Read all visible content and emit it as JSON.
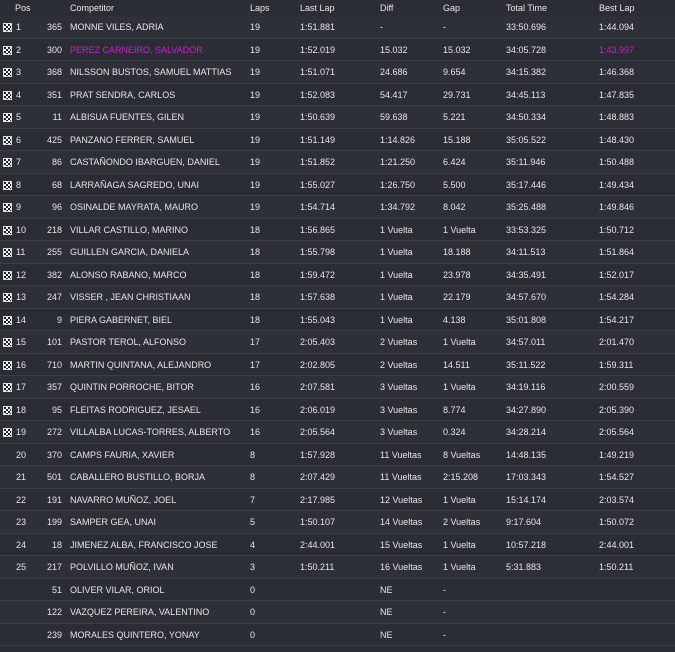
{
  "headers": {
    "pos": "Pos",
    "competitor": "Competitor",
    "laps": "Laps",
    "last_lap": "Last Lap",
    "diff": "Diff",
    "gap": "Gap",
    "total": "Total Time",
    "best": "Best Lap"
  },
  "highlight_color": "#d11cd1",
  "flag_icon": "checkered-flag-icon",
  "rows": [
    {
      "pos": "1",
      "num": "365",
      "name": "MONNE VILES, ADRIA",
      "laps": "19",
      "last": "1:51.881",
      "diff": "-",
      "gap": "-",
      "total": "33:50.696",
      "best": "1:44.094",
      "flag": true,
      "hi": false
    },
    {
      "pos": "2",
      "num": "300",
      "name": "PEREZ CARNEIRO, SALVADOR",
      "laps": "19",
      "last": "1:52.019",
      "diff": "15.032",
      "gap": "15.032",
      "total": "34:05.728",
      "best": "1:43.997",
      "flag": true,
      "hi": true
    },
    {
      "pos": "3",
      "num": "368",
      "name": "NILSSON BUSTOS, SAMUEL MATTIAS",
      "laps": "19",
      "last": "1:51.071",
      "diff": "24.686",
      "gap": "9.654",
      "total": "34:15.382",
      "best": "1:46.368",
      "flag": true,
      "hi": false
    },
    {
      "pos": "4",
      "num": "351",
      "name": "PRAT SENDRA, CARLOS",
      "laps": "19",
      "last": "1:52.083",
      "diff": "54.417",
      "gap": "29.731",
      "total": "34:45.113",
      "best": "1:47.835",
      "flag": true,
      "hi": false
    },
    {
      "pos": "5",
      "num": "11",
      "name": "ALBISUA FUENTES, GILEN",
      "laps": "19",
      "last": "1:50.639",
      "diff": "59.638",
      "gap": "5.221",
      "total": "34:50.334",
      "best": "1:48.883",
      "flag": true,
      "hi": false
    },
    {
      "pos": "6",
      "num": "425",
      "name": "PANZANO FERRER, SAMUEL",
      "laps": "19",
      "last": "1:51.149",
      "diff": "1:14.826",
      "gap": "15.188",
      "total": "35:05.522",
      "best": "1:48.430",
      "flag": true,
      "hi": false
    },
    {
      "pos": "7",
      "num": "86",
      "name": "CASTAÑONDO IBARGUEN, DANIEL",
      "laps": "19",
      "last": "1:51.852",
      "diff": "1:21.250",
      "gap": "6.424",
      "total": "35:11.946",
      "best": "1:50.488",
      "flag": true,
      "hi": false
    },
    {
      "pos": "8",
      "num": "68",
      "name": "LARRAÑAGA SAGREDO, UNAI",
      "laps": "19",
      "last": "1:55.027",
      "diff": "1:26.750",
      "gap": "5.500",
      "total": "35:17.446",
      "best": "1:49.434",
      "flag": true,
      "hi": false
    },
    {
      "pos": "9",
      "num": "96",
      "name": "OSINALDE MAYRATA, MAURO",
      "laps": "19",
      "last": "1:54.714",
      "diff": "1:34.792",
      "gap": "8.042",
      "total": "35:25.488",
      "best": "1:49.846",
      "flag": true,
      "hi": false
    },
    {
      "pos": "10",
      "num": "218",
      "name": "VILLAR CASTILLO, MARINO",
      "laps": "18",
      "last": "1:56.865",
      "diff": "1 Vuelta",
      "gap": "1 Vuelta",
      "total": "33:53.325",
      "best": "1:50.712",
      "flag": true,
      "hi": false
    },
    {
      "pos": "11",
      "num": "255",
      "name": "GUILLEN GARCIA, DANIELA",
      "laps": "18",
      "last": "1:55.798",
      "diff": "1 Vuelta",
      "gap": "18.188",
      "total": "34:11.513",
      "best": "1:51.864",
      "flag": true,
      "hi": false
    },
    {
      "pos": "12",
      "num": "382",
      "name": "ALONSO RABANO, MARCO",
      "laps": "18",
      "last": "1:59.472",
      "diff": "1 Vuelta",
      "gap": "23.978",
      "total": "34:35.491",
      "best": "1:52.017",
      "flag": true,
      "hi": false
    },
    {
      "pos": "13",
      "num": "247",
      "name": "VISSER , JEAN CHRISTIAAN",
      "laps": "18",
      "last": "1:57.638",
      "diff": "1 Vuelta",
      "gap": "22.179",
      "total": "34:57.670",
      "best": "1:54.284",
      "flag": true,
      "hi": false
    },
    {
      "pos": "14",
      "num": "9",
      "name": "PIERA GABERNET, BIEL",
      "laps": "18",
      "last": "1:55.043",
      "diff": "1 Vuelta",
      "gap": "4.138",
      "total": "35:01.808",
      "best": "1:54.217",
      "flag": true,
      "hi": false
    },
    {
      "pos": "15",
      "num": "101",
      "name": "PASTOR TEROL, ALFONSO",
      "laps": "17",
      "last": "2:05.403",
      "diff": "2 Vueltas",
      "gap": "1 Vuelta",
      "total": "34:57.011",
      "best": "2:01.470",
      "flag": true,
      "hi": false
    },
    {
      "pos": "16",
      "num": "710",
      "name": "MARTIN QUINTANA, ALEJANDRO",
      "laps": "17",
      "last": "2:02.805",
      "diff": "2 Vueltas",
      "gap": "14.511",
      "total": "35:11.522",
      "best": "1:59.311",
      "flag": true,
      "hi": false
    },
    {
      "pos": "17",
      "num": "357",
      "name": "QUINTIN PORROCHE, BITOR",
      "laps": "16",
      "last": "2:07.581",
      "diff": "3 Vueltas",
      "gap": "1 Vuelta",
      "total": "34:19.116",
      "best": "2:00.559",
      "flag": true,
      "hi": false
    },
    {
      "pos": "18",
      "num": "95",
      "name": "FLEITAS RODRIGUEZ, JESAEL",
      "laps": "16",
      "last": "2:06.019",
      "diff": "3 Vueltas",
      "gap": "8.774",
      "total": "34:27.890",
      "best": "2:05.390",
      "flag": true,
      "hi": false
    },
    {
      "pos": "19",
      "num": "272",
      "name": "VILLALBA LUCAS-TORRES, ALBERTO",
      "laps": "16",
      "last": "2:05.564",
      "diff": "3 Vueltas",
      "gap": "0.324",
      "total": "34:28.214",
      "best": "2:05.564",
      "flag": true,
      "hi": false
    },
    {
      "pos": "20",
      "num": "370",
      "name": "CAMPS FAURIA, XAVIER",
      "laps": "8",
      "last": "1:57.928",
      "diff": "11 Vueltas",
      "gap": "8 Vueltas",
      "total": "14:48.135",
      "best": "1:49.219",
      "flag": false,
      "hi": false
    },
    {
      "pos": "21",
      "num": "501",
      "name": "CABALLERO BUSTILLO, BORJA",
      "laps": "8",
      "last": "2:07.429",
      "diff": "11 Vueltas",
      "gap": "2:15.208",
      "total": "17:03.343",
      "best": "1:54.527",
      "flag": false,
      "hi": false
    },
    {
      "pos": "22",
      "num": "191",
      "name": "NAVARRO MUÑOZ, JOEL",
      "laps": "7",
      "last": "2:17.985",
      "diff": "12 Vueltas",
      "gap": "1 Vuelta",
      "total": "15:14.174",
      "best": "2:03.574",
      "flag": false,
      "hi": false
    },
    {
      "pos": "23",
      "num": "199",
      "name": "SAMPER GEA, UNAI",
      "laps": "5",
      "last": "1:50.107",
      "diff": "14 Vueltas",
      "gap": "2 Vueltas",
      "total": "9:17.604",
      "best": "1:50.072",
      "flag": false,
      "hi": false
    },
    {
      "pos": "24",
      "num": "18",
      "name": "JIMENEZ ALBA, FRANCISCO JOSE",
      "laps": "4",
      "last": "2:44.001",
      "diff": "15 Vueltas",
      "gap": "1 Vuelta",
      "total": "10:57.218",
      "best": "2:44.001",
      "flag": false,
      "hi": false
    },
    {
      "pos": "25",
      "num": "217",
      "name": "POLVILLO MUÑOZ, IVAN",
      "laps": "3",
      "last": "1:50.211",
      "diff": "16 Vueltas",
      "gap": "1 Vuelta",
      "total": "5:31.883",
      "best": "1:50.211",
      "flag": false,
      "hi": false
    },
    {
      "pos": "",
      "num": "51",
      "name": "OLIVER VILAR, ORIOL",
      "laps": "0",
      "last": "",
      "diff": "NE",
      "gap": "-",
      "total": "",
      "best": "",
      "flag": false,
      "hi": false
    },
    {
      "pos": "",
      "num": "122",
      "name": "VAZQUEZ PEREIRA, VALENTINO",
      "laps": "0",
      "last": "",
      "diff": "NE",
      "gap": "-",
      "total": "",
      "best": "",
      "flag": false,
      "hi": false
    },
    {
      "pos": "",
      "num": "239",
      "name": "MORALES QUINTERO, YONAY",
      "laps": "0",
      "last": "",
      "diff": "NE",
      "gap": "-",
      "total": "",
      "best": "",
      "flag": false,
      "hi": false
    }
  ]
}
